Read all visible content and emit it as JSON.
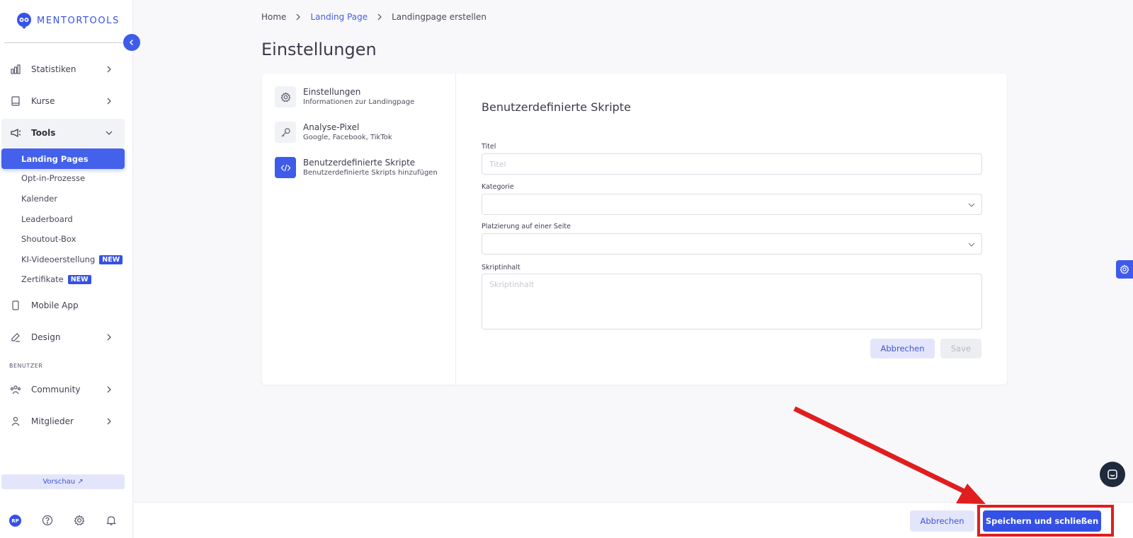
{
  "brand": {
    "name": "MENTORTOOLS",
    "accent": "#3551e5"
  },
  "sidebar": {
    "items": [
      {
        "label": "Statistiken",
        "icon": "bar-chart-icon"
      },
      {
        "label": "Kurse",
        "icon": "book-icon"
      },
      {
        "label": "Tools",
        "icon": "megaphone-icon"
      }
    ],
    "sub_items": [
      {
        "label": "Landing Pages"
      },
      {
        "label": "Opt-in-Prozesse"
      },
      {
        "label": "Kalender"
      },
      {
        "label": "Leaderboard"
      },
      {
        "label": "Shoutout-Box"
      },
      {
        "label": "KI-Videoerstellung",
        "badge": "NEW"
      },
      {
        "label": "Zertifikate",
        "badge": "NEW"
      }
    ],
    "mobile_app": "Mobile App",
    "design": "Design",
    "section_users": "BENUTZER",
    "community": "Community",
    "members": "Mitglieder",
    "preview": "Vorschau ↗",
    "avatar_initials": "RP"
  },
  "breadcrumb": {
    "home": "Home",
    "landing": "Landing Page",
    "current": "Landingpage erstellen"
  },
  "page_title": "Einstellungen",
  "settings_menu": [
    {
      "title": "Einstellungen",
      "subtitle": "Informationen zur Landingpage",
      "icon": "gear-icon"
    },
    {
      "title": "Analyse-Pixel",
      "subtitle": "Google, Facebook, TikTok",
      "icon": "key-icon"
    },
    {
      "title": "Benutzerdefinierte Skripte",
      "subtitle": "Benutzerdefinierte Skripts hinzufügen",
      "icon": "code-icon"
    }
  ],
  "form": {
    "title": "Benutzerdefinierte Skripte",
    "title_label": "Titel",
    "title_placeholder": "Titel",
    "category_label": "Kategorie",
    "placement_label": "Platzierung auf einer Seite",
    "content_label": "Skriptinhalt",
    "content_placeholder": "Skriptinhalt",
    "cancel": "Abbrechen",
    "save": "Save"
  },
  "footer": {
    "cancel": "Abbrechen",
    "save_close": "Speichern und schließen"
  }
}
